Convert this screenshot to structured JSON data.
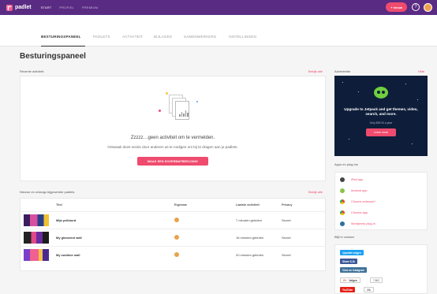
{
  "app": {
    "logo_text": "padlet"
  },
  "topnav": {
    "items": [
      "START",
      "PROFIEL",
      "PREMIUM"
    ]
  },
  "topbar": {
    "new_label": "+ nieuw",
    "help_label": "?"
  },
  "tabs": [
    "BESTURINGSPANEEL",
    "PADLETS",
    "ACTIVITEIT",
    "BIJLAGES",
    "SAMENWERKERS",
    "INSTELLINGEN"
  ],
  "page": {
    "title": "Besturingspaneel"
  },
  "activity": {
    "label": "Recente activiteit",
    "link": "Bekijk alle",
    "empty_title": "Zzzzz…geen activiteit om te vermelden.",
    "empty_text": "Ontwaak deze sectie door anderen uit te nodigen om bij te dragen aan je padlets.",
    "cta_label": "MAAK EEN SCHERMAFBEELDING"
  },
  "padlets": {
    "label": "Nieuwe en onlangs bijgewerkte padlets",
    "link": "Bekijk alle",
    "columns": [
      "Titel",
      "Eigenaar",
      "Laatste activiteit",
      "Privacy"
    ],
    "rows": [
      {
        "title": "Mijn prikbord",
        "last": "7 minuten geleden",
        "privacy": "Secret"
      },
      {
        "title": "My glanzend wall",
        "last": "16 minuten geleden",
        "privacy": "Secret"
      },
      {
        "title": "My sublime wall",
        "last": "20 minuten geleden",
        "privacy": "Secret"
      }
    ]
  },
  "sidebar": {
    "ad_label": "Advertentie",
    "ad_hide": "Hide",
    "ad_text": "Upgrade to Jetpack and get themes, video, search, and more.",
    "ad_sub": "Only $39.00 a year",
    "ad_btn": "Learn more",
    "apps_label": "Apps en plug-ins",
    "apps": [
      {
        "label": "iPad app",
        "color": "#444444"
      },
      {
        "label": "Android app",
        "color": "#8bc34a"
      },
      {
        "label": "Chrome-extensie?",
        "color": "#e9a030"
      },
      {
        "label": "Chrome-app",
        "color": "#e9a030"
      },
      {
        "label": "Wordpress plug-in",
        "color": "#2e6fa0"
      }
    ],
    "contact_label": "Blijf in contact",
    "twitter_label": "@padlet volgen",
    "facebook_label": "Share 9,1k",
    "instagram_label": "View on Instagram",
    "gplus_label": "Volgen",
    "gplus_count": "7.862",
    "youtube_label": "YouTube",
    "youtube_count": "88k"
  },
  "colors": {
    "topbar": "#5a2b82",
    "accent": "#ef4b6e"
  }
}
